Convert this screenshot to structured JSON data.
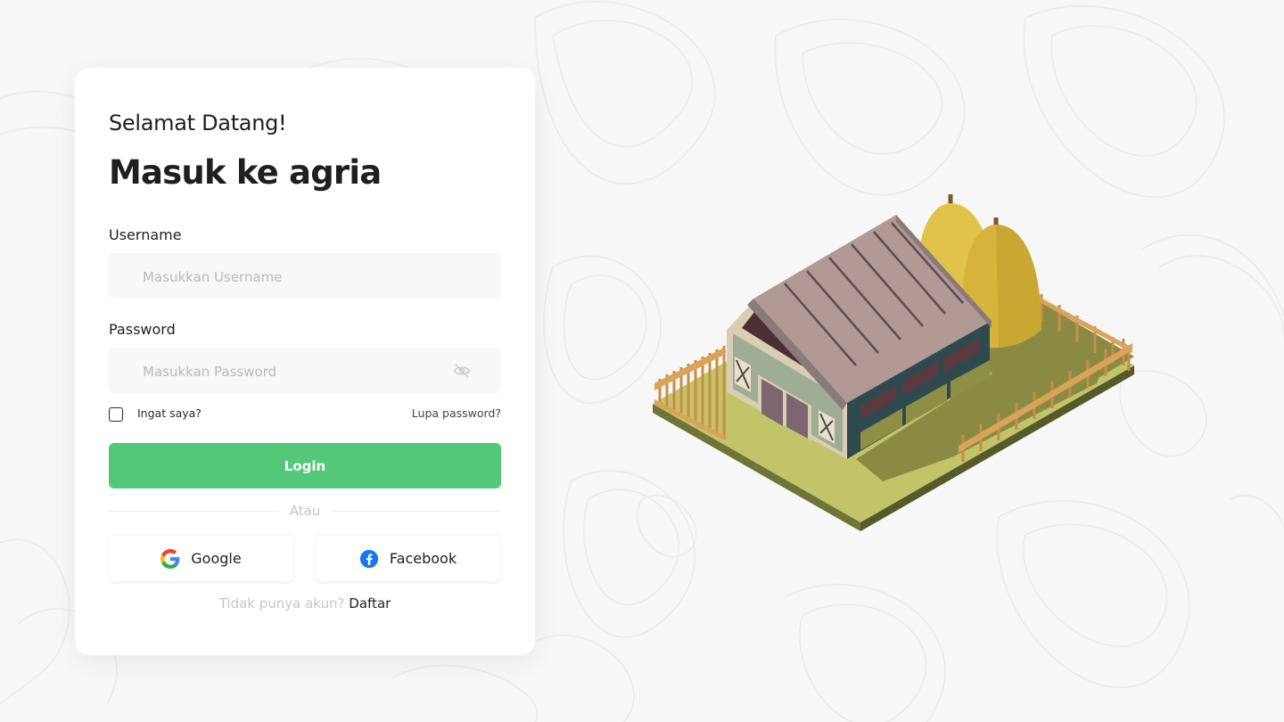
{
  "login": {
    "greeting": "Selamat Datang!",
    "title": "Masuk ke agria",
    "username": {
      "label": "Username",
      "placeholder": "Masukkan Username",
      "value": ""
    },
    "password": {
      "label": "Password",
      "placeholder": "Masukkan Password",
      "value": "",
      "toggle_icon": "eye-off-icon"
    },
    "remember_label": "Ingat saya?",
    "remember_checked": false,
    "forgot_label": "Lupa password?",
    "submit_label": "Login",
    "divider_text": "Atau",
    "social": [
      {
        "label": "Google",
        "icon": "google-icon"
      },
      {
        "label": "Facebook",
        "icon": "facebook-icon"
      }
    ],
    "signup_prompt": "Tidak punya akun?",
    "signup_link": "Daftar"
  },
  "colors": {
    "primary": "#52c878",
    "background": "#f7f7f7",
    "facebook": "#1877f2"
  },
  "illustration": {
    "subject": "isometric farm barn with haystacks and fence",
    "icon": "barn-illustration"
  }
}
